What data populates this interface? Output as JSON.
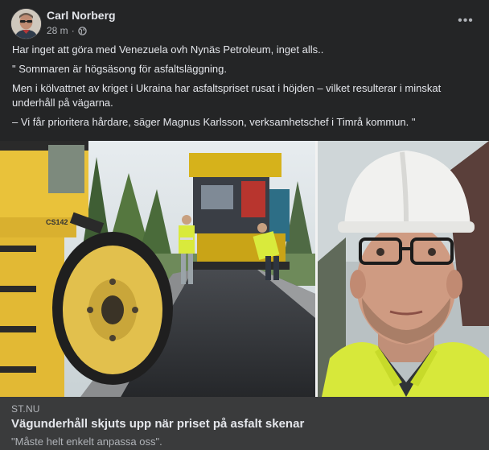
{
  "post": {
    "author": "Carl Norberg",
    "time": "28 m",
    "separator": "·",
    "privacy_icon": "globe-icon",
    "more_icon": "more-horizontal-icon",
    "more_label": "•••",
    "paragraphs": [
      "Har inget att göra med Venezuela ovh Nynäs Petroleum, inget alls..",
      "\" Sommaren är högsäsong för asfaltsläggning.",
      "Men i kölvattnet av kriget i Ukraina har asfaltspriset rusat i höjden – vilket resulterar i minskat underhåll på vägarna.",
      "– Vi får prioritera hårdare, säger Magnus Karlsson, verksamhetschef i Timrå kommun. \""
    ]
  },
  "media": {
    "roller_label": "CS142"
  },
  "link": {
    "source": "ST.NU",
    "title": "Vägunderhåll skjuts upp när priset på asfalt skenar",
    "subtitle": "\"Måste helt enkelt anpassa oss\"."
  },
  "colors": {
    "background": "#242526",
    "card": "#3a3b3c",
    "text_primary": "#e4e6eb",
    "text_secondary": "#b0b3b8",
    "hivis_yellow": "#d7e83a"
  }
}
